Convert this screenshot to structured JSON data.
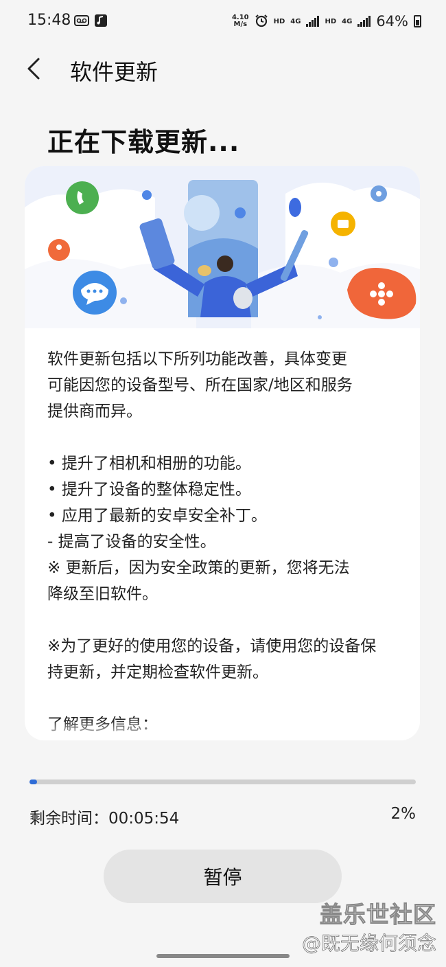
{
  "status_bar": {
    "time": "15:48",
    "net_speed_value": "4.10",
    "net_speed_unit": "M/s",
    "hd1": "HD",
    "sig1": "4G",
    "hd2": "HD",
    "sig2": "4G",
    "battery": "64%",
    "icons": [
      "voicemail-icon",
      "music-note-icon",
      "alarm-icon",
      "signal-icon",
      "battery-icon"
    ]
  },
  "header": {
    "title": "软件更新",
    "back_icon": "chevron-left-icon"
  },
  "page": {
    "heading": "正在下载更新..."
  },
  "release_notes": {
    "intro": "软件更新包括以下所列功能改善，具体变更\n可能因您的设备型号、所在国家/地区和服务\n提供商而异。",
    "items": [
      "• 提升了相机和相册的功能。",
      "• 提升了设备的整体稳定性。",
      "• 应用了最新的安卓安全补丁。",
      " - 提高了设备的安全性。",
      "※ 更新后，因为安全政策的更新，您将无法\n降级至旧软件。"
    ],
    "note": "※为了更好的使用您的设备，请使用您的设备保\n持更新，并定期检查软件更新。",
    "more_info_label": "了解更多信息："
  },
  "download": {
    "progress": 0.02,
    "remaining_label": "剩余时间：",
    "remaining_value": "00:05:54",
    "percent": "2%"
  },
  "buttons": {
    "pause": "暂停"
  },
  "watermark": {
    "line1": "盖乐世社区",
    "line2": "@既无缘何须念"
  },
  "colors": {
    "accent": "#2f6cd6",
    "button_bg": "#e4e4e4",
    "background": "#f5f5f5"
  }
}
